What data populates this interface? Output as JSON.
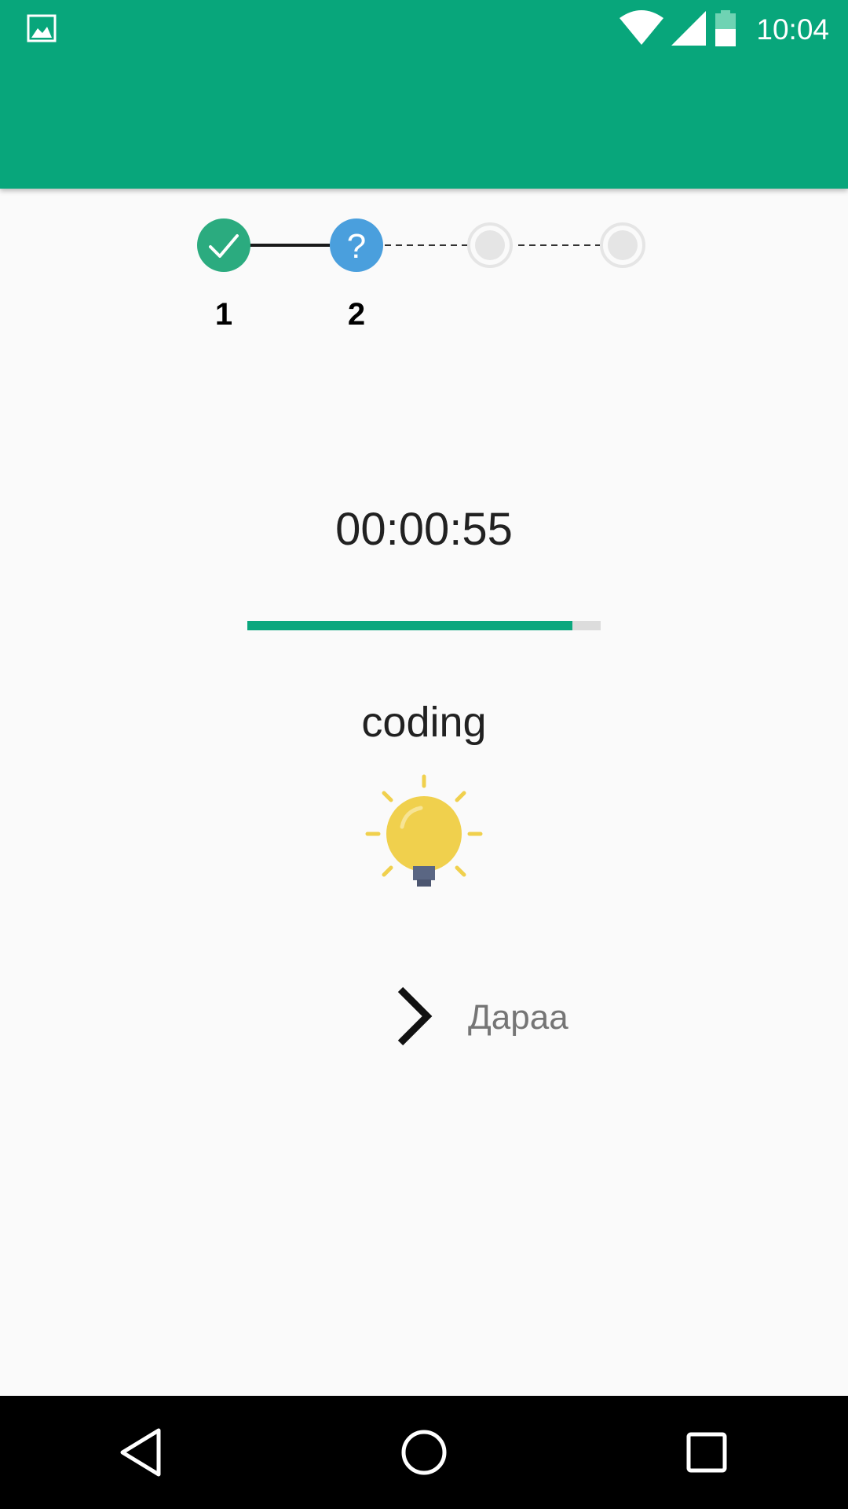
{
  "status_bar": {
    "time": "10:04",
    "icons": [
      "image-notification-icon",
      "wifi-icon",
      "cell-signal-icon",
      "battery-icon"
    ]
  },
  "colors": {
    "primary": "#08a67b",
    "step_done": "#2bab7f",
    "step_current": "#4a9fdd",
    "step_pending": "#e5e5e5",
    "bulb": "#f0d04d",
    "bulb_base": "#5a6683"
  },
  "stepper": {
    "steps": [
      {
        "label": "1",
        "state": "done",
        "icon": "check-icon"
      },
      {
        "label": "2",
        "state": "current",
        "icon": "question-icon"
      },
      {
        "label": "",
        "state": "pending",
        "icon": "pending-dot-icon"
      },
      {
        "label": "",
        "state": "pending",
        "icon": "pending-dot-icon"
      }
    ]
  },
  "timer": {
    "text": "00:00:55",
    "progress_percent": 92
  },
  "word": {
    "text": "coding",
    "icon": "lightbulb-icon"
  },
  "next_button": {
    "label": "Дараа",
    "icon": "chevron-right-icon"
  },
  "nav_bar": {
    "buttons": [
      "back-icon",
      "home-icon",
      "recents-icon"
    ]
  }
}
